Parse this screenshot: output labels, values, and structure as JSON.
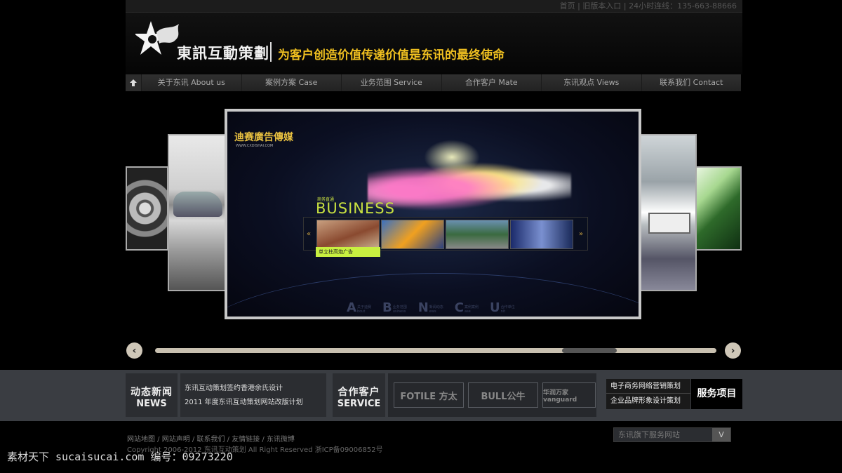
{
  "topbar": {
    "links": "首页 | 旧版本入口 | 24小时连线：135-663-88666"
  },
  "header": {
    "brand": "東訊互動策劃",
    "slogan": "为客户创造价值传递价值是东讯的最终使命"
  },
  "nav": {
    "items": [
      {
        "label": "关于东讯 About us"
      },
      {
        "label": "案例方案  Case"
      },
      {
        "label": "业务范围 Service"
      },
      {
        "label": "合作客户 Mate"
      },
      {
        "label": "东讯观点 Views"
      },
      {
        "label": "联系我们 Contact"
      }
    ]
  },
  "slide": {
    "brand": "迪赛廣告傳媒",
    "url": "WWW.CXDISHAI.COM",
    "business_small": "商务直通",
    "business": "BUSINESS",
    "caption": "单立柱高炮广告",
    "prev": "«",
    "next": "»",
    "bottom_nav": [
      {
        "letter": "A",
        "text_cn": "关于迪赛",
        "text_en": "bout"
      },
      {
        "letter": "B",
        "text_cn": "业务范围",
        "text_en": "usiness"
      },
      {
        "letter": "N",
        "text_cn": "新闻动态",
        "text_en": "ews"
      },
      {
        "letter": "C",
        "text_cn": "案例案例",
        "text_en": "ase"
      },
      {
        "letter": "U",
        "text_cn": "合作单位",
        "text_en": "nit"
      }
    ]
  },
  "scroll": {
    "prev": "‹",
    "next": "›"
  },
  "news": {
    "title_cn": "动态新闻",
    "title_en": "NEWS",
    "items": [
      "东讯互动策划签约香港余氏设计",
      "2011 年度东讯互动策划网站改版计划"
    ]
  },
  "service": {
    "title_cn": "合作客户",
    "title_en": "SERVICE",
    "partners": [
      "FOTILE 方太",
      "BULL公牛",
      "华润万家 vanguard"
    ]
  },
  "services": {
    "links": [
      "电子商务网络营销策划",
      "企业品牌形象设计策划"
    ],
    "title": "服务项目"
  },
  "footer": {
    "links": [
      "网站地图",
      "网站声明",
      "联系我们",
      "友情链接",
      "东讯微博"
    ],
    "separator": " / ",
    "copyright": "Copyright 2006-2012 东讯互动策划 All Right Reserved  浙ICP备09006852号",
    "select_label": "东讯旗下服务网站",
    "select_btn": "V"
  },
  "watermark": "素材天下 sucaisucai.com  编号：09273220"
}
